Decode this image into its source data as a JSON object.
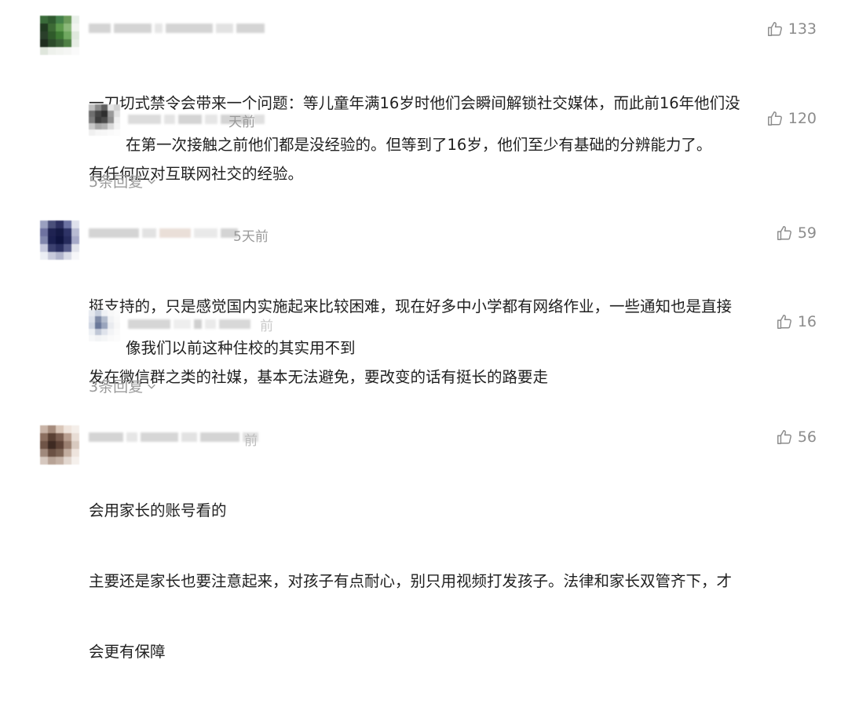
{
  "comments": [
    {
      "likes": "133",
      "text_lines": [
        "一刀切式禁令会带来一个问题：等儿童年满16岁时他们会瞬间解锁社交媒体，而此前16年他们没",
        "有任何应对互联网社交的经验。"
      ],
      "avatar_colors": [
        "#3a6b3a",
        "#2f5a2f",
        "#44804a",
        "#6a9a5a",
        "#e8efe8",
        "#213a21",
        "#3c6a35",
        "#5d9a4d",
        "#8bb87a",
        "#f1f4ef",
        "#2a3f2a",
        "#2f5a2a",
        "#3e7a34",
        "#70a860",
        "#dfe8dc",
        "#1e2c1e",
        "#2c4a2a",
        "#3a5f36",
        "#4f7f45",
        "#e6ece4",
        "#dfe6dc",
        "#eef1ec",
        "#f2f4f0",
        "#f5f6f4",
        "#fafafa"
      ],
      "reply": {
        "time_tail": "天前",
        "likes": "120",
        "text": "在第一次接触之前他们都是没经验的。但等到了16岁，他们至少有基础的分辨能力了。",
        "avatar_colors": [
          "#bdbdbd",
          "#8a8a8a",
          "#5d5d5d",
          "#e6e6e6",
          "#d2d2d2",
          "#6f6f6f",
          "#454545",
          "#2f2f2f",
          "#9a9a9a",
          "#e2e2e2",
          "#7b7b7b",
          "#3c3c3c",
          "#4b4b4b",
          "#8e8e8e",
          "#efefef",
          "#c8c8c8",
          "#a8a8a8",
          "#b3b3b3",
          "#dadada",
          "#f4f4f4",
          "#f0f0f0",
          "#f6f6f6",
          "#f7f7f7",
          "#fafafa",
          "#fcfcfc"
        ]
      },
      "more_replies": "5条回复"
    },
    {
      "time_tail": "5天前",
      "likes": "59",
      "text_lines": [
        "挺支持的，只是感觉国内实施起来比较困难，现在好多中小学都有网络作业，一些通知也是直接",
        "发在微信群之类的社媒，基本无法避免，要改变的话有挺长的路要走"
      ],
      "avatar_colors": [
        "#9aa0c0",
        "#4a4f7a",
        "#2d3060",
        "#6c72a2",
        "#dfe1ec",
        "#6e72a0",
        "#1f2352",
        "#151a45",
        "#2e3366",
        "#b8bbd3",
        "#8187ad",
        "#1b2050",
        "#0f1440",
        "#262b5c",
        "#a6a9c8",
        "#c5c8dc",
        "#3c4170",
        "#2a2f60",
        "#575c8a",
        "#e2e3ec",
        "#eceef4",
        "#c8cadb",
        "#b1b4cb",
        "#d9dbe6",
        "#f6f6f9"
      ],
      "reply": {
        "time_tail": "前",
        "likes": "16",
        "text": "像我们以前这种住校的其实用不到",
        "avatar_colors": [
          "#e6e9ef",
          "#c9d0de",
          "#f0f2f5",
          "#f8f8f8",
          "#fbfbfb",
          "#dbe0ea",
          "#7e8aa6",
          "#b3bccd",
          "#f1f2f4",
          "#f9f9f9",
          "#cfd5e2",
          "#6a789a",
          "#9aa5bd",
          "#e9ebef",
          "#f7f7f7",
          "#edf0f4",
          "#c0c7d6",
          "#dfe3eb",
          "#f3f4f6",
          "#fafafa",
          "#f7f8f9",
          "#f2f3f5",
          "#f5f6f7",
          "#fafafa",
          "#fcfcfc"
        ]
      },
      "more_replies": "3条回复"
    },
    {
      "time_tail": "前",
      "likes": "56",
      "text_lines": [
        "会用家长的账号看的",
        "主要还是家长也要注意起来，对孩子有点耐心，别只用视频打发孩子。法律和家长双管齐下，才",
        "会更有保障"
      ],
      "avatar_colors": [
        "#c8b3a6",
        "#a58b7c",
        "#d9c6b8",
        "#efe4dc",
        "#f4eee9",
        "#8c6f60",
        "#5a4033",
        "#7b5e50",
        "#b89e8f",
        "#e8ddd5",
        "#6f5447",
        "#3e2a22",
        "#5d4236",
        "#9a7f70",
        "#d8c9bf",
        "#a0897c",
        "#6b5144",
        "#7d6455",
        "#c2ad9f",
        "#eee4dd",
        "#d6c8bf",
        "#b7a396",
        "#c4b1a5",
        "#e2d7cf",
        "#f5f0ec"
      ]
    }
  ],
  "icons": {
    "like": "thumbs-up-icon",
    "chevron": "chevron-down-icon"
  }
}
